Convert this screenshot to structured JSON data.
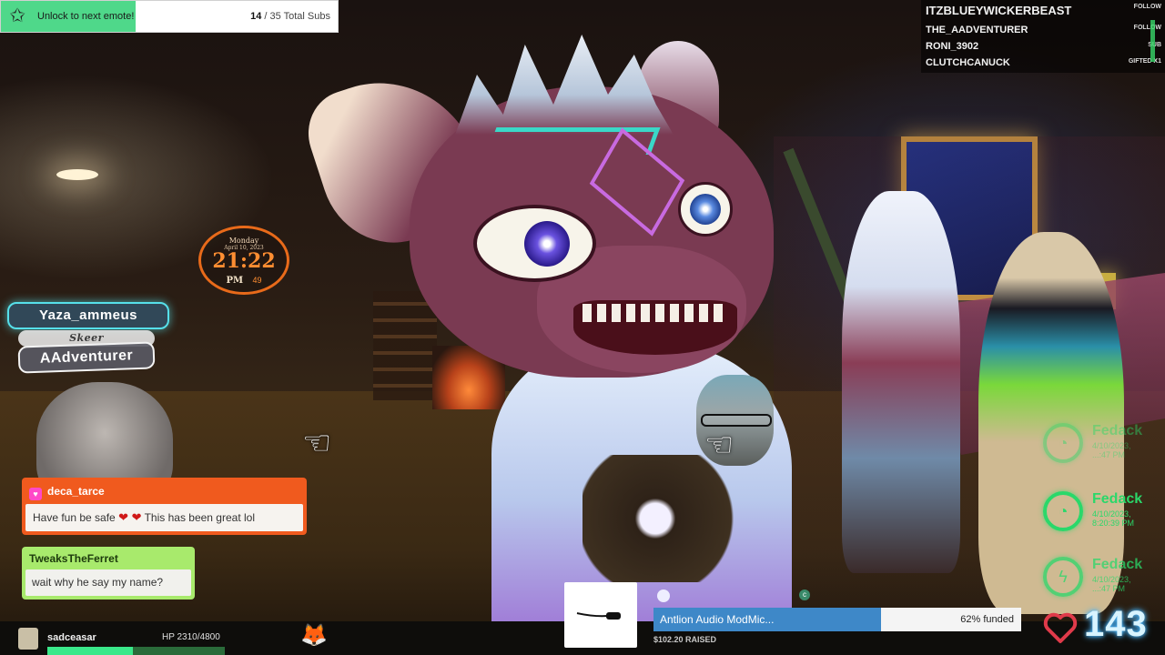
{
  "sub_goal": {
    "label": "Unlock to next emote!",
    "count_current": "14",
    "count_rest": " / 35 Total Subs",
    "progress": 0.4,
    "icon": "star-icon"
  },
  "events": [
    {
      "name": "ITZBLUEYWICKERBEAST",
      "tag": "FOLLOW"
    },
    {
      "name": "THE_AADVENTURER",
      "tag": "FOLLOW"
    },
    {
      "name": "RONI_3902",
      "tag": "SUB"
    },
    {
      "name": "CLUTCHCANUCK",
      "tag": "GIFTED X1"
    }
  ],
  "world_clock": {
    "day": "Monday",
    "date": "April 10, 2023",
    "time": "21:22",
    "ampm": "PM",
    "seconds": "49"
  },
  "nameplates": {
    "yaza": "Yaza_ammeus",
    "speaker": "Skeer",
    "aadventurer": "AAdventurer"
  },
  "chat": [
    {
      "user": "deca_tarce",
      "message_start": "Have fun be safe ",
      "hearts": "❤ ❤",
      "message_end": " This has been great lol",
      "color": "#f05a1e"
    },
    {
      "user": "TweaksTheFerret",
      "message": "wait why he say my name?",
      "color": "#a8ea6c"
    }
  ],
  "hp": {
    "name": "sadceasar",
    "stat": "HP 2310/4800",
    "fraction": 0.48
  },
  "donation_goal": {
    "label": "Antlion Audio ModMic...",
    "percent_text": "62% funded",
    "fraction": 0.62,
    "raised": "$102.20 RAISED"
  },
  "hearts": {
    "count": "143",
    "icon": "heart-icon",
    "color": "#e03a4a"
  },
  "timers": [
    {
      "name": "Fedack",
      "date_line1": "4/10/2023,",
      "date_line2": "...:47 PM",
      "icon": "clock-icon"
    },
    {
      "name": "Fedack",
      "date_line1": "4/10/2023,",
      "date_line2": "8:20:39 PM",
      "icon": "clock-icon"
    },
    {
      "name": "Fedack",
      "date_line1": "4/10/2023,",
      "date_line2": "...:47 PM",
      "icon": "lightning-icon"
    }
  ],
  "colors": {
    "sub_goal_fill": "#4fd88a",
    "donation_fill": "#3e88c8",
    "timer_green": "#2ad86a",
    "nameplate_glow": "#56e0ea"
  }
}
